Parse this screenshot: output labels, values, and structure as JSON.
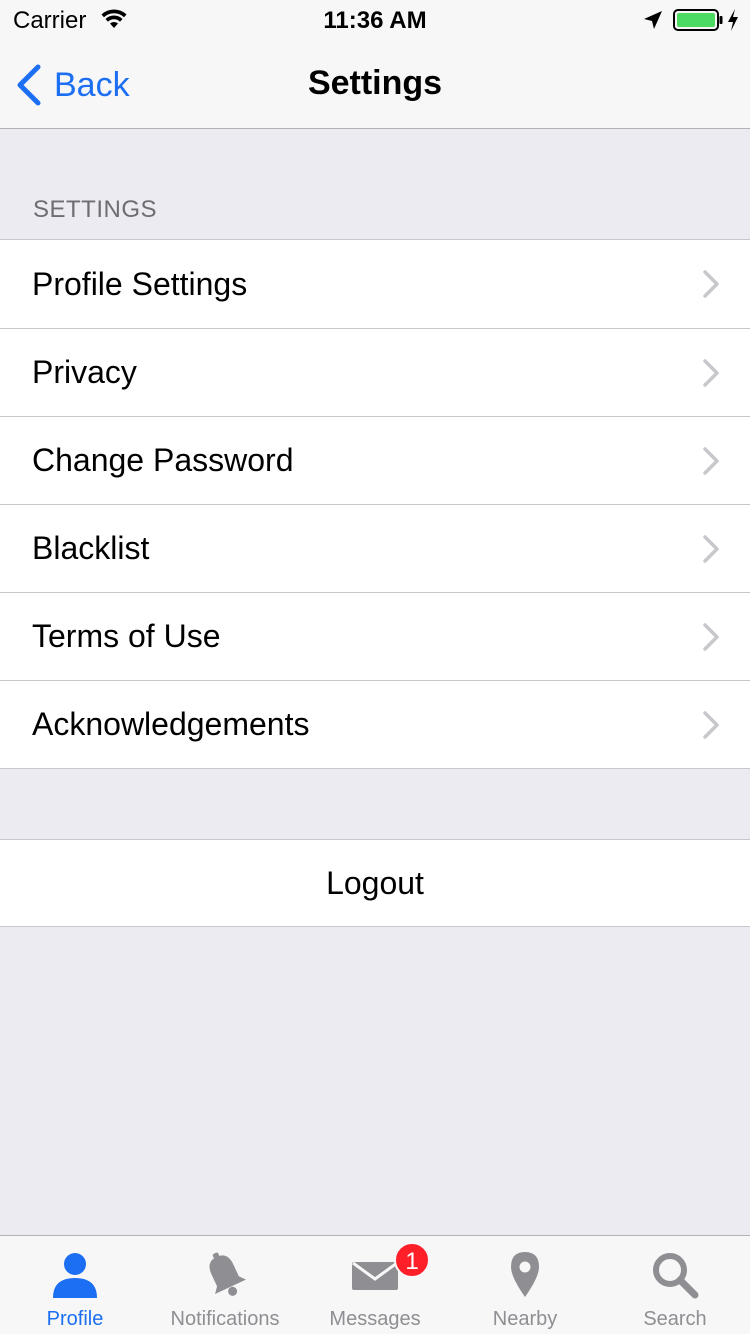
{
  "status_bar": {
    "carrier": "Carrier",
    "time": "11:36 AM",
    "battery_color": "#4cd964"
  },
  "nav": {
    "back_label": "Back",
    "title": "Settings",
    "accent_color": "#1c6ef2"
  },
  "settings": {
    "section_header": "SETTINGS",
    "items": [
      {
        "label": "Profile Settings",
        "icon": "chevron-right-icon"
      },
      {
        "label": "Privacy",
        "icon": "chevron-right-icon"
      },
      {
        "label": "Change Password",
        "icon": "chevron-right-icon"
      },
      {
        "label": "Blacklist",
        "icon": "chevron-right-icon"
      },
      {
        "label": "Terms of Use",
        "icon": "chevron-right-icon"
      },
      {
        "label": "Acknowledgements",
        "icon": "chevron-right-icon"
      }
    ]
  },
  "logout": {
    "label": "Logout"
  },
  "tab_bar": {
    "active_tab": "Profile",
    "tabs": [
      {
        "label": "Profile",
        "icon": "person-icon"
      },
      {
        "label": "Notifications",
        "icon": "bell-icon"
      },
      {
        "label": "Messages",
        "icon": "envelope-icon",
        "badge": "1"
      },
      {
        "label": "Nearby",
        "icon": "map-pin-icon"
      },
      {
        "label": "Search",
        "icon": "magnifier-icon"
      }
    ]
  }
}
